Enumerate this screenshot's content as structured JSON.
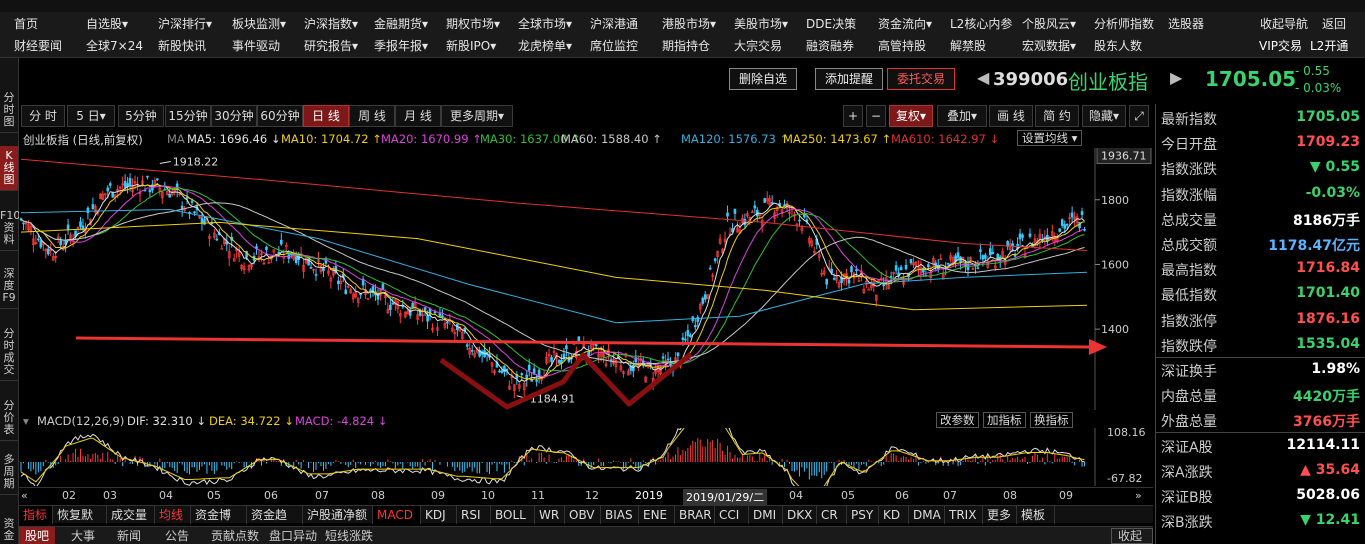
{
  "nav": {
    "row1": [
      "首页",
      "自选股▾",
      "沪深排行▾",
      "板块监测▾",
      "沪深指数▾",
      "金融期货▾",
      "期权市场▾",
      "全球市场▾",
      "沪深港通",
      "港股市场▾",
      "美股市场▾",
      "DDE决策",
      "资金流向▾",
      "L2核心内参",
      "个股风云▾",
      "分析师指数",
      "选股器",
      "收起导航",
      "返回"
    ],
    "row2": [
      "财经要闻",
      "全球7×24",
      "新股快讯",
      "事件驱动",
      "研究报告▾",
      "季报年报▾",
      "新股IPO▾",
      "龙虎榜单▾",
      "席位监控",
      "期指持仓",
      "大宗交易",
      "融资融券",
      "高管持股",
      "解禁股",
      "宏观数据▾",
      "股东人数",
      "VIP交易",
      "L2开通"
    ]
  },
  "leftbar": [
    "分时图",
    "K线图",
    "F10资料",
    "深度F9",
    "分时成交",
    "分价表",
    "多周期",
    "资金"
  ],
  "header": {
    "delete_watch": "删除自选",
    "add_alert": "添加提醒",
    "trade": "委托交易",
    "code": "399006",
    "name": "创业板指",
    "price": "1705.05",
    "change": "- 0.55",
    "change_pct": "- 0.03%"
  },
  "toolbar": {
    "periods": [
      "分 时",
      "5 日▾",
      "5分钟",
      "15分钟",
      "30分钟",
      "60分钟",
      "日 线",
      "周 线",
      "月 线",
      "更多周期▾"
    ],
    "active": "日 线",
    "right": [
      "+",
      "−",
      "复权▾",
      "叠加▾",
      "画 线",
      "简 约",
      "隐藏▾"
    ]
  },
  "ma": {
    "title": "创业板指 (日线,前复权)",
    "ma_tag": "MA",
    "items": [
      {
        "text": "MA5: 1696.46 ↓",
        "color": "#e0e0e0"
      },
      {
        "text": "MA10: 1704.72 ↑",
        "color": "#f0d000"
      },
      {
        "text": "MA20: 1670.99 ↑",
        "color": "#e040e0"
      },
      {
        "text": "MA30: 1637.00 ↑",
        "color": "#30c030"
      },
      {
        "text": "MA60: 1588.40 ↑",
        "color": "#c8c8c8"
      },
      {
        "text": "MA120: 1576.73 ↑",
        "color": "#30b0e0"
      },
      {
        "text": "MA250: 1473.67 ↑",
        "color": "#f0d000"
      },
      {
        "text": "MA610: 1642.97 ↓",
        "color": "#e03030"
      }
    ],
    "settings": "设置均线 ▾"
  },
  "chart_data": {
    "type": "line",
    "title": "创业板指 (日线,前复权)",
    "xlabel": "",
    "ylabel": "",
    "y_ticks": [
      1400.0,
      1600.0,
      1800.0
    ],
    "y_top_label": "1936.71",
    "ylim": [
      1150,
      1960
    ],
    "x_ticks": [
      "02",
      "03",
      "04",
      "05",
      "06",
      "07",
      "08",
      "09",
      "10",
      "11",
      "12",
      "2019",
      "2019/01/29/二",
      "04",
      "05",
      "06",
      "07",
      "08",
      "09"
    ],
    "annotations": [
      {
        "text": "1918.22",
        "value": 1918.22
      },
      {
        "text": "1184.91",
        "value": 1184.91
      }
    ],
    "series": [
      {
        "name": "MA610",
        "color": "#e03030"
      },
      {
        "name": "MA250",
        "color": "#f0d000"
      },
      {
        "name": "MA120",
        "color": "#30b0e0"
      }
    ],
    "grid": false,
    "legend": "top-left"
  },
  "macd": {
    "label": "MACD(12,26,9)",
    "dif": "DIF: 32.310 ↓",
    "dea": "DEA: 34.722 ↓",
    "macd": "MACD: -4.824 ↓",
    "buttons": [
      "改参数",
      "加指标",
      "换指标"
    ],
    "top": "108.16",
    "bottom": "-67.82"
  },
  "indicators": {
    "items": [
      "指标",
      "恢复默认",
      "成交量",
      "均线",
      "资金博弈",
      "资金趋势",
      "沪股通净额",
      "MACD",
      "KDJ",
      "RSI",
      "BOLL",
      "WR",
      "OBV",
      "BIAS",
      "ENE",
      "BRAR",
      "CCI",
      "DMI",
      "DKX",
      "CR",
      "PSY",
      "KD",
      "DMA",
      "TRIX",
      "更多",
      "模板"
    ],
    "active": "MACD"
  },
  "bottom": {
    "items": [
      "股吧",
      "大事",
      "新闻",
      "公告",
      "贡献点数",
      "盘口异动",
      "短线涨跌"
    ],
    "collapse": "收起 ▾"
  },
  "panel": [
    {
      "label": "最新指数",
      "value": "1705.05",
      "color": "#3ad36b"
    },
    {
      "label": "今日开盘",
      "value": "1709.23",
      "color": "#ff5050"
    },
    {
      "label": "指数涨跌",
      "value": "▼ 0.55",
      "color": "#3ad36b"
    },
    {
      "label": "指数涨幅",
      "value": "-0.03%",
      "color": "#3ad36b"
    },
    {
      "label": "总成交量",
      "value": "8186万手",
      "color": "#ffffff"
    },
    {
      "label": "总成交额",
      "value": "1178.47亿元",
      "color": "#5ab4ff"
    },
    {
      "label": "最高指数",
      "value": "1716.84",
      "color": "#ff5050"
    },
    {
      "label": "最低指数",
      "value": "1701.40",
      "color": "#3ad36b"
    },
    {
      "label": "指数涨停",
      "value": "1876.16",
      "color": "#ff5050"
    },
    {
      "label": "指数跌停",
      "value": "1535.04",
      "color": "#3ad36b"
    },
    {
      "label": "深证换手",
      "value": "1.98%",
      "color": "#ffffff"
    },
    {
      "label": "内盘总量",
      "value": "4420万手",
      "color": "#3ad36b"
    },
    {
      "label": "外盘总量",
      "value": "3766万手",
      "color": "#ff5050"
    },
    {
      "label": "深证A股",
      "value": "12114.11",
      "color": "#ffffff"
    },
    {
      "label": "深A涨跌",
      "value": "▲ 35.64",
      "color": "#ff5050"
    },
    {
      "label": "深证B股",
      "value": "5028.06",
      "color": "#ffffff"
    },
    {
      "label": "深B涨跌",
      "value": "▼ 12.41",
      "color": "#3ad36b"
    }
  ]
}
